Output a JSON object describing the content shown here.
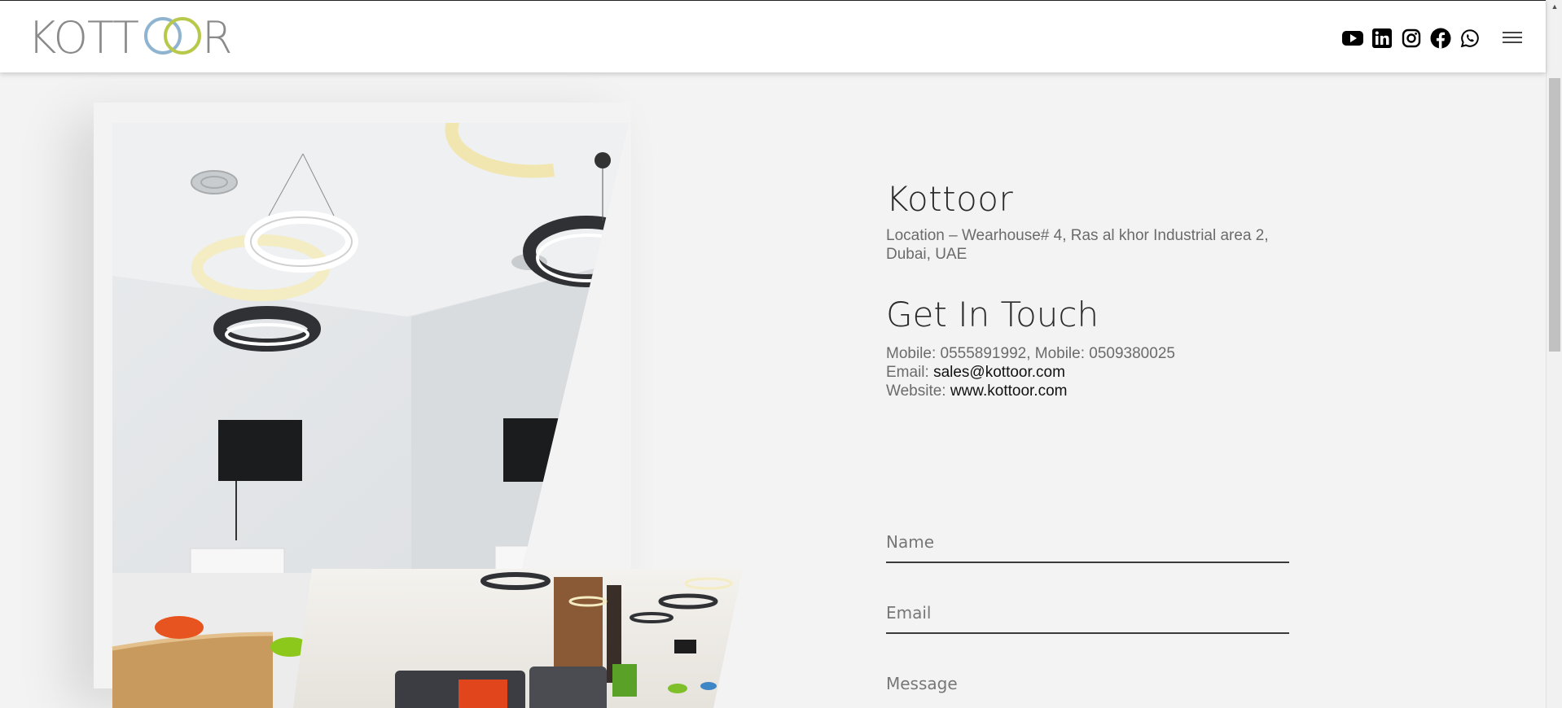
{
  "header": {
    "logo_text": "KOTTOOR",
    "social": [
      {
        "icon": "youtube-icon"
      },
      {
        "icon": "linkedin-icon"
      },
      {
        "icon": "instagram-icon"
      },
      {
        "icon": "facebook-icon"
      },
      {
        "icon": "whatsapp-icon"
      }
    ],
    "menu_icon": "hamburger-menu-icon"
  },
  "company": {
    "name": "Kottoor",
    "address_line1": "Location – Wearhouse# 4, Ras al khor Industrial area 2,",
    "address_line2": "Dubai, UAE"
  },
  "contact": {
    "heading": "Get In Touch",
    "mobiles": "Mobile: 0555891992, Mobile: 0509380025",
    "email_label": "Email: ",
    "email": "sales@kottoor.com",
    "website_label": "Website: ",
    "website": "www.kottoor.com"
  },
  "form": {
    "name_placeholder": "Name",
    "email_placeholder": "Email",
    "message_placeholder": "Message"
  },
  "colors": {
    "logo_gray": "#8a8a8a",
    "logo_blue": "#8fb4cf",
    "logo_green": "#b8c84a",
    "background": "#f3f3f3"
  }
}
